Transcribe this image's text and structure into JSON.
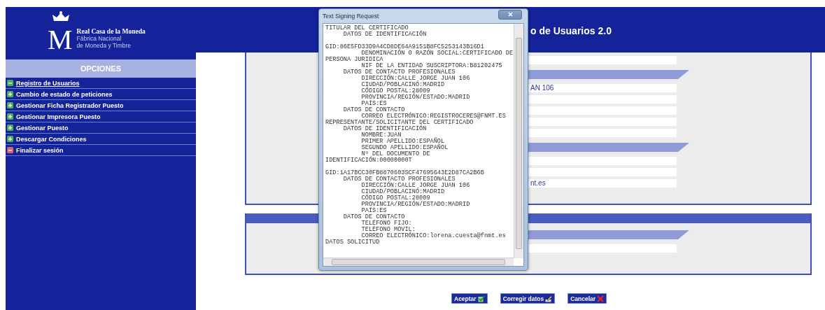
{
  "logo": {
    "monogram": "M",
    "line_1": "Real Casa de la Moneda",
    "line_2": "Fábrica Nacional",
    "line_3": "de Moneda y Timbre"
  },
  "sidebar": {
    "heading": "OPCIONES",
    "items": [
      {
        "label": "Registro de Usuarios",
        "kind": "open",
        "selected": true
      },
      {
        "label": "Cambio de estado de peticiones",
        "kind": "closed",
        "selected": false
      },
      {
        "label": "Gestionar Ficha Registrador Puesto",
        "kind": "closed",
        "selected": false
      },
      {
        "label": "Gestionar Impresora Puesto",
        "kind": "closed",
        "selected": false
      },
      {
        "label": "Gestionar Puesto",
        "kind": "closed",
        "selected": false
      },
      {
        "label": "Descargar Condiciones",
        "kind": "closed",
        "selected": false
      },
      {
        "label": "Finalizar sesión",
        "kind": "exit",
        "selected": false
      }
    ]
  },
  "page_title": "o de Usuarios 2.0",
  "panels": [
    {
      "kind": "plain",
      "rows": [
        {
          "kind": "field"
        },
        {
          "kind": "section"
        },
        {
          "kind": "field",
          "value": "AN 106"
        },
        {
          "kind": "field"
        },
        {
          "kind": "field"
        },
        {
          "kind": "field"
        },
        {
          "kind": "field"
        },
        {
          "kind": "section"
        },
        {
          "kind": "field"
        },
        {
          "kind": "field"
        },
        {
          "kind": "field",
          "value": "nt.es"
        }
      ]
    },
    {
      "kind": "headed",
      "rows": [
        {
          "kind": "section"
        },
        {
          "kind": "field"
        }
      ]
    }
  ],
  "dialog": {
    "title": "Text Signing Request",
    "blocks": [
      [
        "TITULAR DEL CERTIFICADO",
        "     DATOS DE IDENTIFICACIÓN"
      ],
      [
        "GID:86E5FD33D9A4CD8DE64A9151B8FC5253143B16D1",
        "          DENOMINACIÓN O RAZÓN SOCIAL:CERTIFICADO DE",
        "PERSONA JURIDICA",
        "          NIF DE LA ENTIDAD SUSCRIPTORA:B81202475",
        "     DATOS DE CONTACTO PROFESIONALES",
        "          DIRECCIÓN:CALLE JORGE JUAN 106",
        "          CIUDAD/POBLACINÓ:MADRID",
        "          CÓDIGO POSTAL:28009",
        "          PROVINCIA/REGIÓN/ESTADO:MADRID",
        "          PAÍS:ES",
        "     DATOS DE CONTACTO",
        "          CORREO ELECTRÓNICO:REGISTROCERES@FNMT.ES",
        "REPRESENTANTE/SOLICITANTE DEL CERTIFICADO",
        "     DATOS DE IDENTIFICACIÓN",
        "          NOMBRE:JUAN",
        "          PRIMER APELLIDO:ESPAÑOL",
        "          SEGUNDO APELLIDO:ESPAÑOL",
        "          Nº DEL DOCUMENTO DE",
        "IDENTIFICACIÓN:00000000T"
      ],
      [
        "GID:1A17BCC30FB8870603SCF47695643E2D87CA2B6B",
        "     DATOS DE CONTACTO PROFESIONALES",
        "          DIRECCIÓN:CALLE JORGE JUAN 106",
        "          CIUDAD/POBLACINÓ:MADRID",
        "          CÓDIGO POSTAL:28009",
        "          PROVINCIA/REGIÓN/ESTADO:MADRID",
        "          PAÍS:ES",
        "     DATOS DE CONTACTO",
        "          TELÉFONO FIJO:",
        "          TELÉFONO MOVIL:",
        "          CORREO ELECTRÓNICO:lorena.cuesta@fnmt.es",
        "DATOS SOLICITUD"
      ]
    ]
  },
  "buttons": [
    {
      "label": "Aceptar",
      "kind": "accept"
    },
    {
      "label": "Corregir datos",
      "kind": "edit"
    },
    {
      "label": "Cancelar",
      "kind": "cancel"
    }
  ]
}
